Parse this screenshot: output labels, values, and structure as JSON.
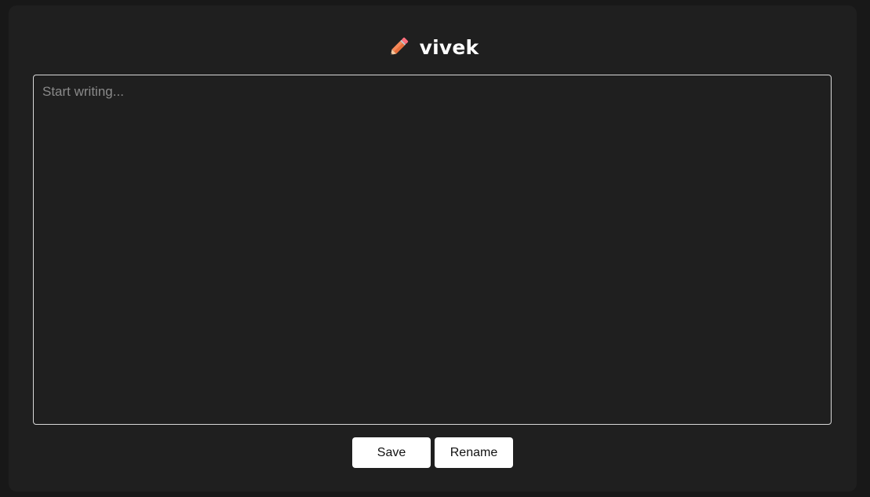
{
  "header": {
    "icon": "pencil-icon",
    "title": "vivek"
  },
  "editor": {
    "value": "",
    "placeholder": "Start writing..."
  },
  "actions": {
    "save_label": "Save",
    "rename_label": "Rename"
  },
  "colors": {
    "page_background": "#181818",
    "card_background": "#1f1f1f",
    "button_background": "#ffffff",
    "pencil_body": "#f5895a",
    "pencil_eraser": "#ff6f7d"
  }
}
